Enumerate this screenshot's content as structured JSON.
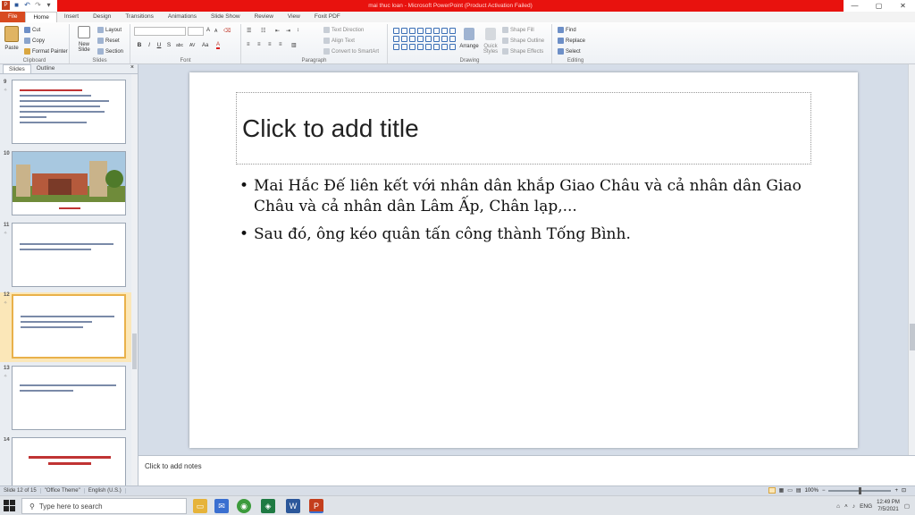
{
  "window": {
    "title": "mai thuc loan - Microsoft PowerPoint (Product Activation Failed)",
    "min": "—",
    "max": "▢",
    "close": "✕"
  },
  "tabs": [
    "File",
    "Home",
    "Insert",
    "Design",
    "Transitions",
    "Animations",
    "Slide Show",
    "Review",
    "View",
    "Foxit PDF"
  ],
  "ribbon": {
    "clipboard": {
      "paste": "Paste",
      "cut": "Cut",
      "copy": "Copy",
      "format_painter": "Format Painter",
      "label": "Clipboard"
    },
    "slides": {
      "new_slide": "New Slide",
      "layout": "Layout",
      "reset": "Reset",
      "section": "Section",
      "label": "Slides"
    },
    "font": {
      "label": "Font",
      "bold": "B",
      "italic": "I",
      "underline": "U",
      "strike": "S",
      "shadow": "abc",
      "spacing": "AV",
      "case": "Aa",
      "color": "A",
      "grow": "A",
      "shrink": "A"
    },
    "paragraph": {
      "text_direction": "Text Direction",
      "align_text": "Align Text",
      "smartart": "Convert to SmartArt",
      "label": "Paragraph"
    },
    "drawing": {
      "arrange": "Arrange",
      "quick_styles": "Quick Styles",
      "shape_fill": "Shape Fill",
      "shape_outline": "Shape Outline",
      "shape_effects": "Shape Effects",
      "label": "Drawing"
    },
    "editing": {
      "find": "Find",
      "replace": "Replace",
      "select": "Select",
      "label": "Editing"
    }
  },
  "left_pane": {
    "tab_slides": "Slides",
    "tab_outline": "Outline",
    "close": "×",
    "thumbs": [
      {
        "num": "9"
      },
      {
        "num": "10"
      },
      {
        "num": "11"
      },
      {
        "num": "12"
      },
      {
        "num": "13"
      },
      {
        "num": "14"
      }
    ]
  },
  "slide": {
    "title_placeholder": "Click to add title",
    "bullets": [
      "Mai Hắc Đế liên kết với nhân dân khắp Giao Châu và cả nhân dân Giao Châu và cả nhân dân Lâm Ấp, Chân lạp,...",
      "Sau đó, ông kéo quân tấn công thành Tống Bình."
    ]
  },
  "notes_placeholder": "Click to add notes",
  "status": {
    "slide_info": "Slide 12 of 15",
    "theme": "\"Office Theme\"",
    "language": "English (U.S.)",
    "zoom": "100%",
    "zoom_fraction": 0.5
  },
  "taskbar": {
    "search_placeholder": "Type here to search",
    "lang": "ENG",
    "time": "12:49 PM",
    "date": "7/5/2021"
  },
  "colors": {
    "title_red": "#e8120e",
    "file_tab": "#d84a20",
    "selected_thumb": "#e9b14a"
  }
}
